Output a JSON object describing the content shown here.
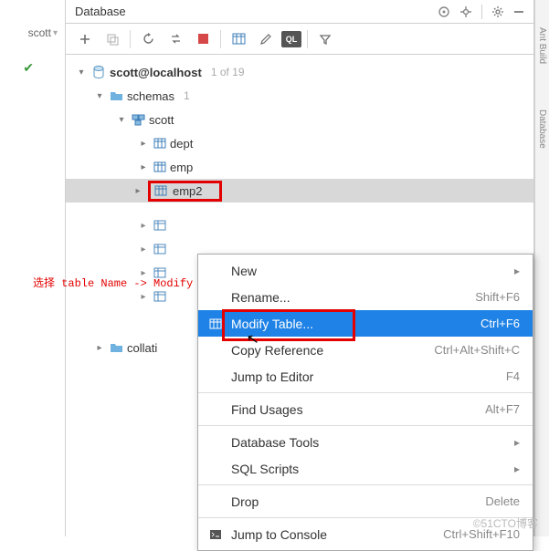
{
  "breadcrumb": {
    "label": "scott"
  },
  "panel": {
    "title": "Database"
  },
  "tree": {
    "connection": {
      "label": "scott@localhost",
      "meta": "1 of 19"
    },
    "schemas": {
      "label": "schemas",
      "meta": "1"
    },
    "schema": {
      "label": "scott"
    },
    "tables": [
      {
        "label": "dept"
      },
      {
        "label": "emp"
      },
      {
        "label": "emp2"
      }
    ],
    "collations": {
      "label": "collati"
    }
  },
  "annotation": "选择 table Name -> Modify Table",
  "context_menu": [
    {
      "label": "New",
      "submenu": true
    },
    {
      "label": "Rename...",
      "shortcut": "Shift+F6"
    },
    {
      "label": "Modify Table...",
      "shortcut": "Ctrl+F6",
      "selected": true,
      "boxed": true,
      "icon": "table"
    },
    {
      "label": "Copy Reference",
      "shortcut": "Ctrl+Alt+Shift+C"
    },
    {
      "label": "Jump to Editor",
      "shortcut": "F4"
    },
    {
      "sep": true
    },
    {
      "label": "Find Usages",
      "shortcut": "Alt+F7"
    },
    {
      "sep": true
    },
    {
      "label": "Database Tools",
      "submenu": true
    },
    {
      "label": "SQL Scripts",
      "submenu": true
    },
    {
      "sep": true
    },
    {
      "label": "Drop",
      "shortcut": "Delete"
    },
    {
      "sep": true
    },
    {
      "label": "Jump to Console",
      "shortcut": "Ctrl+Shift+F10",
      "icon": "console"
    }
  ],
  "watermark": "©51CTO博客"
}
